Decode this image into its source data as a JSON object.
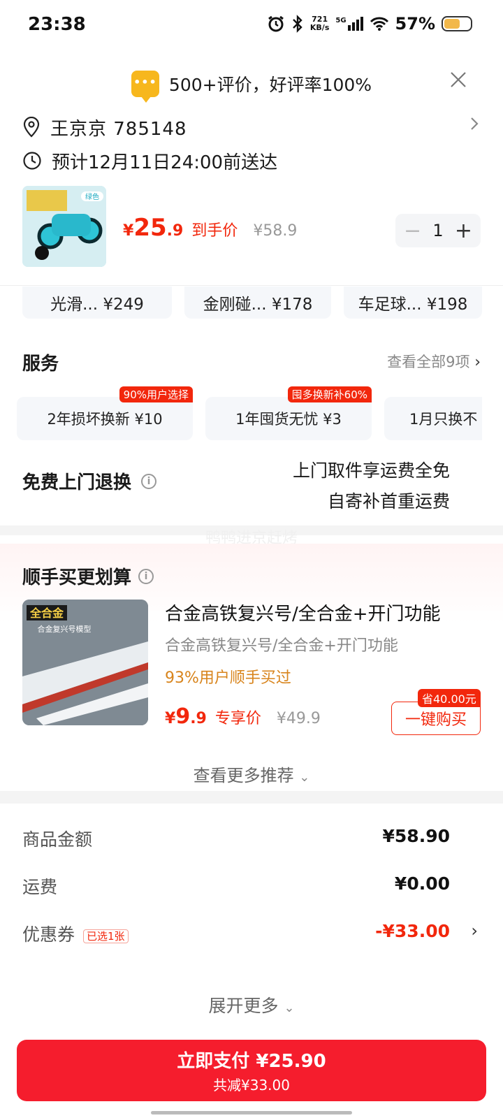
{
  "status_bar": {
    "time": "23:38",
    "net_speed_value": "721",
    "net_speed_unit": "KB/s",
    "network": "5G",
    "battery": "57%"
  },
  "review_banner": {
    "icon": "chat-bubble-icon",
    "text": "500+评价，好评率100%"
  },
  "address": {
    "name_code": "王京京  785148",
    "eta": "预计12月11日24:00前送达"
  },
  "product": {
    "image_label": "绿色",
    "price_currency": "¥",
    "price_int": "25",
    "price_dec": ".9",
    "price_label": "到手价",
    "original_price": "¥58.9",
    "quantity": "1",
    "qty_minus": "−",
    "qty_plus": "+"
  },
  "options": [
    {
      "label": "光滑...  ¥249"
    },
    {
      "label": "金刚碰...  ¥178"
    },
    {
      "label": "车足球...  ¥198"
    }
  ],
  "services": {
    "title": "服务",
    "more": "查看全部9项",
    "items": [
      {
        "label": "2年损坏换新  ¥10",
        "badge": "90%用户选择"
      },
      {
        "label": "1年囤货无忧  ¥3",
        "badge": "囤多换新补60%"
      },
      {
        "label": "1月只换不",
        "badge": ""
      }
    ]
  },
  "free_return": {
    "title": "免费上门退换",
    "line1": "上门取件享运费全免",
    "line2": "自寄补首重运费"
  },
  "watermark": "鸭鸭进京赶烤",
  "addon": {
    "title": "顺手买更划算",
    "image_text": "全合金",
    "image_sub": "合金复兴号模型",
    "name": "合金高铁复兴号/全合金+开门功能",
    "sub": "合金高铁复兴号/全合金+开门功能",
    "pct": "93%用户顺手买过",
    "price_currency": "¥",
    "price_int": "9",
    "price_dec": ".9",
    "price_label": "专享价",
    "original_price": "¥49.9",
    "save_badge": "省40.00元",
    "buy_label": "一键购买",
    "see_more": "查看更多推荐"
  },
  "summary": {
    "goods_label": "商品金额",
    "goods_value": "¥58.90",
    "shipping_label": "运费",
    "shipping_value": "¥0.00",
    "coupon_label": "优惠券",
    "coupon_tag": "已选1张",
    "coupon_value": "-¥33.00",
    "expand": "展开更多"
  },
  "pay": {
    "main": "立即支付 ¥25.90",
    "sub": "共减¥33.00"
  },
  "colors": {
    "accent_red": "#f2270c",
    "pay_button": "#f51d2d",
    "badge_yellow": "#f7b71d"
  }
}
